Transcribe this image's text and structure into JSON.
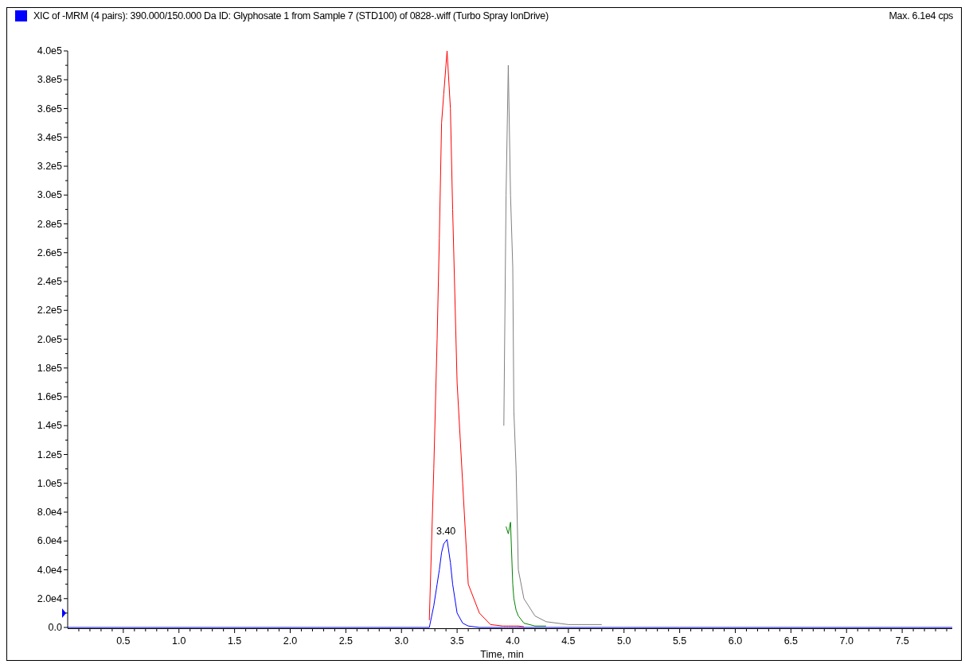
{
  "header": {
    "title": "XIC of -MRM (4 pairs): 390.000/150.000 Da ID: Glyphosate 1 from Sample 7 (STD100) of 0828-.wiff (Turbo Spray IonDrive)",
    "max": "Max. 6.1e4 cps"
  },
  "chart": {
    "chart_data": {
      "type": "line",
      "xlabel": "Time, min",
      "xlim": [
        0,
        7.95
      ],
      "ylim": [
        0,
        400000
      ],
      "xticks": [
        {
          "value": 0.5,
          "label": "0.5"
        },
        {
          "value": 1,
          "label": "1.0"
        },
        {
          "value": 1.5,
          "label": "1.5"
        },
        {
          "value": 2,
          "label": "2.0"
        },
        {
          "value": 2.5,
          "label": "2.5"
        },
        {
          "value": 3,
          "label": "3.0"
        },
        {
          "value": 3.5,
          "label": "3.5"
        },
        {
          "value": 4,
          "label": "4.0"
        },
        {
          "value": 4.5,
          "label": "4.5"
        },
        {
          "value": 5,
          "label": "5.0"
        },
        {
          "value": 5.5,
          "label": "5.5"
        },
        {
          "value": 6,
          "label": "6.0"
        },
        {
          "value": 6.5,
          "label": "6.5"
        },
        {
          "value": 7,
          "label": "7.0"
        },
        {
          "value": 7.5,
          "label": "7.5"
        }
      ],
      "yticks": [
        {
          "value": 0,
          "label": "0.0"
        },
        {
          "value": 20000,
          "label": "2.0e4"
        },
        {
          "value": 40000,
          "label": "4.0e4"
        },
        {
          "value": 60000,
          "label": "6.0e4"
        },
        {
          "value": 80000,
          "label": "8.0e4"
        },
        {
          "value": 100000,
          "label": "1.0e5"
        },
        {
          "value": 120000,
          "label": "1.2e5"
        },
        {
          "value": 140000,
          "label": "1.4e5"
        },
        {
          "value": 160000,
          "label": "1.6e5"
        },
        {
          "value": 180000,
          "label": "1.8e5"
        },
        {
          "value": 200000,
          "label": "2.0e5"
        },
        {
          "value": 220000,
          "label": "2.2e5"
        },
        {
          "value": 240000,
          "label": "2.4e5"
        },
        {
          "value": 260000,
          "label": "2.6e5"
        },
        {
          "value": 280000,
          "label": "2.8e5"
        },
        {
          "value": 300000,
          "label": "3.0e5"
        },
        {
          "value": 320000,
          "label": "3.2e5"
        },
        {
          "value": 340000,
          "label": "3.4e5"
        },
        {
          "value": 360000,
          "label": "3.6e5"
        },
        {
          "value": 380000,
          "label": "3.8e5"
        },
        {
          "value": 400000,
          "label": "4.0e5"
        }
      ],
      "x": [
        0,
        3.2,
        3.25,
        3.29,
        3.32,
        3.34,
        3.36,
        3.38,
        3.41,
        3.44,
        3.46,
        3.5,
        3.55,
        3.6,
        3.7,
        3.8,
        3.91,
        3.92,
        3.94,
        3.96,
        3.98,
        4.0,
        4.01,
        4.03,
        4.05,
        4.1,
        4.2,
        4.3,
        4.5,
        4.8,
        5.0,
        5.5,
        7.95
      ],
      "series": [
        {
          "color": "#ff0000",
          "values": [
            null,
            null,
            5000,
            110000,
            200000,
            270000,
            350000,
            370000,
            400000,
            360000,
            290000,
            170000,
            100000,
            30000,
            10000,
            2000,
            1000,
            1000,
            1000,
            1000,
            1000,
            1000,
            1000,
            1000,
            1000,
            500,
            null,
            null,
            null,
            null,
            null,
            null,
            null
          ]
        },
        {
          "color": "#808080",
          "values": [
            null,
            null,
            null,
            null,
            null,
            null,
            null,
            null,
            null,
            null,
            null,
            null,
            null,
            null,
            null,
            null,
            null,
            140000,
            300000,
            390000,
            300000,
            250000,
            150000,
            110000,
            40000,
            20000,
            8000,
            4000,
            2000,
            2000,
            null,
            null,
            null
          ]
        },
        {
          "color": "#008000",
          "values": [
            null,
            null,
            null,
            null,
            null,
            null,
            null,
            null,
            null,
            null,
            null,
            null,
            null,
            null,
            null,
            null,
            null,
            null,
            70000,
            65000,
            73000,
            30000,
            20000,
            12000,
            8000,
            3000,
            1000,
            1000,
            null,
            null,
            null,
            null,
            null
          ]
        },
        {
          "color": "#0000ff",
          "values": [
            0,
            0,
            0,
            15000,
            30000,
            40000,
            52000,
            58000,
            61000,
            45000,
            30000,
            10000,
            3000,
            1000,
            0,
            0,
            0,
            0,
            0,
            0,
            0,
            0,
            0,
            0,
            0,
            0,
            0,
            0,
            0,
            0,
            0,
            0,
            0
          ]
        }
      ],
      "annotations": [
        {
          "x": 3.4,
          "y": 61000,
          "text": "3.40"
        }
      ]
    }
  }
}
